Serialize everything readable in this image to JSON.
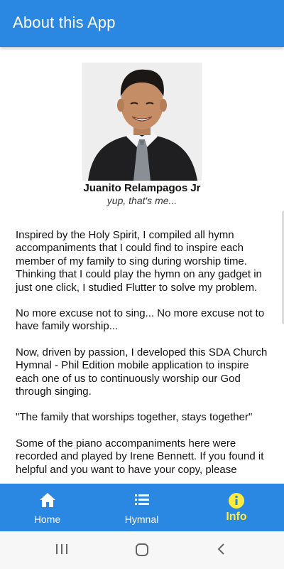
{
  "app_bar": {
    "title": "About this App"
  },
  "profile": {
    "name": "Juanito Relampagos Jr",
    "caption": "yup, that's me..."
  },
  "about": {
    "paragraphs": [
      "Inspired by the Holy Spirit, I compiled all hymn accompaniments that I could find to inspire each member of my family to sing during worship time. Thinking that I could play the hymn on any gadget in just one click, I studied Flutter to solve my problem.",
      "No more excuse not to sing... No more excuse not to have family worship...",
      "Now, driven by passion, I developed this SDA Church Hymnal - Phil Edition mobile application to inspire each one of us to continuously worship our God through singing.",
      "\"The family that worships together, stays together\"",
      "Some of the piano accompaniments here were recorded and played by Irene Bennett. If you found it helpful and you want to have your copy, please"
    ]
  },
  "bottom_nav": {
    "items": [
      {
        "label": "Home",
        "icon": "home-icon"
      },
      {
        "label": "Hymnal",
        "icon": "list-icon"
      },
      {
        "label": "Info",
        "icon": "info-icon",
        "active": true
      }
    ]
  },
  "system_nav": {
    "buttons": [
      "recent-apps-icon",
      "home-circle-icon",
      "back-icon"
    ]
  },
  "colors": {
    "primary": "#2b88e2",
    "active": "#ffeb3b",
    "text": "#111111"
  }
}
